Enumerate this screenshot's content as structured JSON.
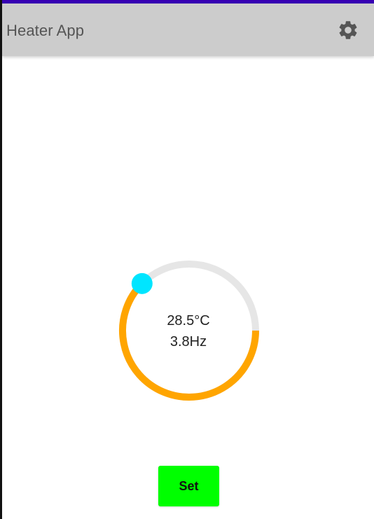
{
  "app_bar": {
    "title": "Heater App",
    "settings_icon": "gear-icon"
  },
  "dial": {
    "temperature": "28.5°C",
    "frequency": "3.8Hz",
    "level_fraction": 0.625,
    "colors": {
      "track": "#e6e6e6",
      "progress": "#ffa500",
      "thumb": "#00e5ff"
    }
  },
  "set_button": {
    "label": "Set",
    "color": "#00ff00"
  },
  "colors": {
    "status_bar": "#3700b3",
    "app_bar": "#cccccc",
    "settings_icon": "#555555"
  }
}
